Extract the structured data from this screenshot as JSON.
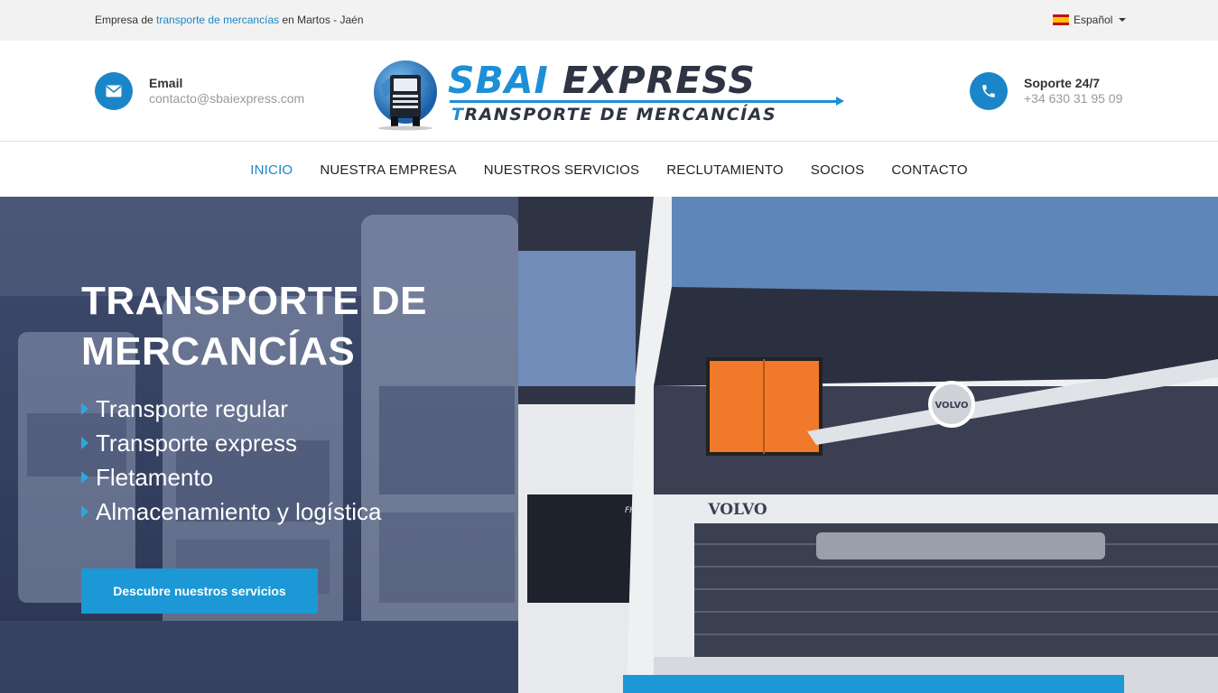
{
  "topbar": {
    "text_before": "Empresa de ",
    "link": "transporte de mercancías",
    "text_after": " en Martos - Jaén",
    "language": "Español"
  },
  "header": {
    "email_label": "Email",
    "email_value": "contacto@sbaiexpress.com",
    "support_label": "Soporte 24/7",
    "support_value": "+34 630 31 95 09",
    "logo_word1": "SBAI",
    "logo_word2": "EXPRESS",
    "logo_sub_first": "T",
    "logo_sub_rest": "RANSPORTE DE MERCANCÍAS"
  },
  "nav": {
    "items": [
      {
        "label": "INICIO",
        "active": true
      },
      {
        "label": "NUESTRA EMPRESA"
      },
      {
        "label": "NUESTROS SERVICIOS"
      },
      {
        "label": "RECLUTAMIENTO"
      },
      {
        "label": "SOCIOS"
      },
      {
        "label": "CONTACTO"
      }
    ]
  },
  "hero": {
    "title_line1": "TRANSPORTE DE",
    "title_line2": "MERCANCÍAS",
    "services": [
      "Transporte regular",
      "Transporte express",
      "Fletamento",
      "Almacenamiento y logística"
    ],
    "cta_label": "Descubre nuestros servicios",
    "truck_brand": "VOLVO",
    "truck_model": "FH"
  },
  "colors": {
    "accent": "#1a86c7",
    "cta": "#1b98d5",
    "logo_dark": "#2e3444"
  }
}
